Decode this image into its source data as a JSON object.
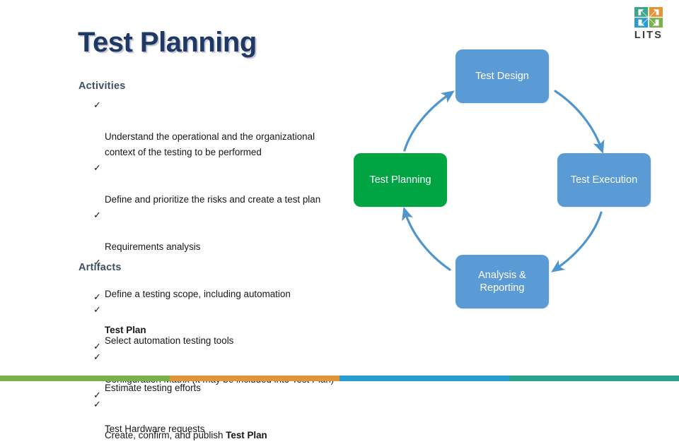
{
  "slide": {
    "title": "Test Planning"
  },
  "activities": {
    "heading": "Activities",
    "items": [
      "Understand the operational and the organizational\ncontext of the testing to be performed",
      "Define and prioritize the risks and create a test plan",
      "Requirements analysis",
      "Define a testing scope, including automation",
      "Select automation testing tools",
      "Estimate testing efforts",
      "Create, confirm, and publish Test Plan"
    ],
    "bullet_glyph": "✓"
  },
  "artifacts": {
    "heading": "Artifacts",
    "items": [
      "Test Plan",
      "Configuration Matrix (it may be included into Test Plan)",
      "Test Hardware requests"
    ],
    "bullet_glyph": "✓"
  },
  "cycle_diagram": {
    "nodes": [
      {
        "label": "Test Design",
        "color": "#5B9BD5",
        "position": "top"
      },
      {
        "label": "Test Execution",
        "color": "#5B9BD5",
        "position": "right"
      },
      {
        "label": "Analysis &\nReporting",
        "color": "#5B9BD5",
        "position": "bottom"
      },
      {
        "label": "Test Planning",
        "color": "#00A443",
        "position": "left"
      }
    ],
    "arrow_color": "#5096CE",
    "flow_order": [
      "Test Planning",
      "Test Design",
      "Test Execution",
      "Analysis & Reporting"
    ]
  },
  "brand": {
    "name": "LITS",
    "logo_colors": {
      "top_left": "#3FA58B",
      "top_right": "#E2943B",
      "bottom_left": "#2A9CD0",
      "bottom_right": "#78B14B"
    }
  },
  "bottom_bar": {
    "segments": [
      "#78B14B",
      "#E2943B",
      "#2A9CD0",
      "#2BA08C"
    ]
  }
}
